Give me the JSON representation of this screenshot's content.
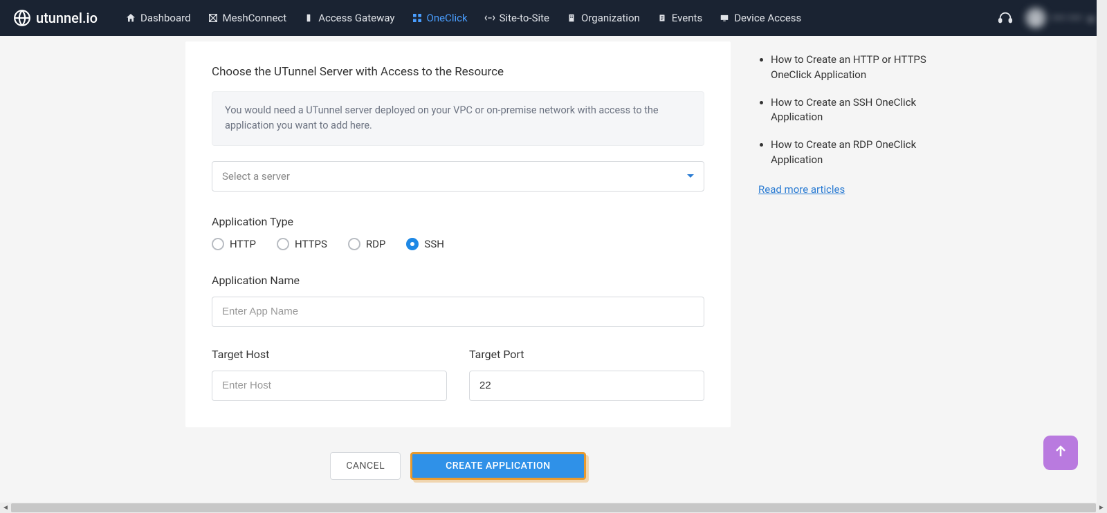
{
  "brand": "utunnel.io",
  "nav": {
    "items": [
      {
        "label": "Dashboard",
        "icon": "home-icon"
      },
      {
        "label": "MeshConnect",
        "icon": "mesh-icon"
      },
      {
        "label": "Access Gateway",
        "icon": "gateway-icon"
      },
      {
        "label": "OneClick",
        "icon": "grid-icon",
        "active": true
      },
      {
        "label": "Site-to-Site",
        "icon": "link-icon"
      },
      {
        "label": "Organization",
        "icon": "org-icon"
      },
      {
        "label": "Events",
        "icon": "events-icon"
      },
      {
        "label": "Device Access",
        "icon": "device-icon"
      }
    ]
  },
  "user": {
    "name": "•••• ••••"
  },
  "form": {
    "section_title": "Choose the UTunnel Server with Access to the Resource",
    "info": "You would need a UTunnel server deployed on your VPC or on-premise network with access to the application you want to add here.",
    "server_select_placeholder": "Select a server",
    "app_type_label": "Application Type",
    "app_types": [
      {
        "label": "HTTP",
        "checked": false
      },
      {
        "label": "HTTPS",
        "checked": false
      },
      {
        "label": "RDP",
        "checked": false
      },
      {
        "label": "SSH",
        "checked": true
      }
    ],
    "app_name_label": "Application Name",
    "app_name_placeholder": "Enter App Name",
    "target_host_label": "Target Host",
    "target_host_placeholder": "Enter Host",
    "target_port_label": "Target Port",
    "target_port_value": "22",
    "cancel_label": "CANCEL",
    "submit_label": "CREATE APPLICATION"
  },
  "help": {
    "links": [
      "How to Create an HTTP or HTTPS OneClick Application",
      "How to Create an SSH OneClick Application",
      "How to Create an RDP OneClick Application"
    ],
    "read_more": "Read more articles"
  },
  "colors": {
    "nav_bg": "#1a2332",
    "accent": "#4a9eff",
    "primary_btn": "#2f91e8",
    "highlight_border": "#e89a2f",
    "fab": "#b97adf"
  }
}
